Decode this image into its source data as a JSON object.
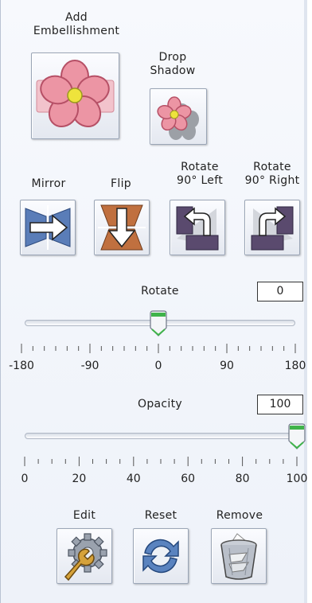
{
  "embellish": {
    "add_label_line1": "Add",
    "add_label_line2": "Embellishment",
    "shadow_label_line1": "Drop",
    "shadow_label_line2": "Shadow",
    "flower_icon": "flower-icon",
    "shadow_icon": "flower-shadow-icon"
  },
  "transform": {
    "mirror_label": "Mirror",
    "flip_label": "Flip",
    "rotate_left_line1": "Rotate",
    "rotate_left_line2": "90° Left",
    "rotate_right_line1": "Rotate",
    "rotate_right_line2": "90° Right"
  },
  "rotate": {
    "label": "Rotate",
    "value": "0",
    "min": -180,
    "max": 180,
    "current": 0,
    "tick_labels": [
      "-180",
      "-90",
      "0",
      "90",
      "180"
    ]
  },
  "opacity": {
    "label": "Opacity",
    "value": "100",
    "min": 0,
    "max": 100,
    "current": 100,
    "tick_labels": [
      "0",
      "20",
      "40",
      "60",
      "80",
      "100"
    ]
  },
  "actions": {
    "edit_label": "Edit",
    "reset_label": "Reset",
    "remove_label": "Remove"
  },
  "colors": {
    "petal": "#e88a9a",
    "petal_dark": "#c4566a",
    "center": "#e6e23a",
    "arrow_blue": "#4a6ca8",
    "flip_brown": "#b8663a",
    "thumb_green": "#3fb34a"
  }
}
